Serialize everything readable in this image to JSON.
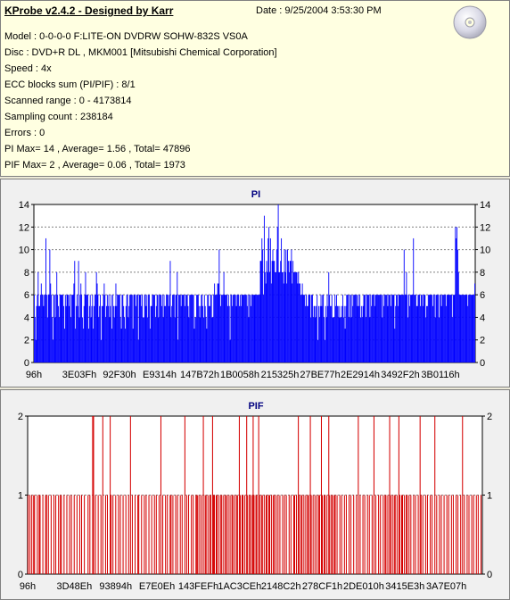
{
  "header": {
    "title": "KProbe v2.4.2 - Designed by Karr",
    "date": "Date : 9/25/2004 3:53:30 PM"
  },
  "info_lines": [
    "Model : 0-0-0-0 F:LITE-ON DVDRW SOHW-832S  VS0A",
    "Disc : DVD+R DL , MKM001 [Mitsubishi Chemical Corporation]",
    "Speed : 4x",
    "ECC blocks sum (PI/PIF) : 8/1",
    "Scanned range : 0 - 4173814",
    "Sampling count : 238184",
    "Errors : 0",
    "PI Max= 14 , Average= 1.56 , Total= 47896",
    "PIF Max= 2 , Average= 0.06 , Total= 1973"
  ],
  "icons": {
    "disc": "cd-disc-icon"
  },
  "colors": {
    "pi": "#0000ff",
    "pif": "#d40000",
    "info_bg": "#ffffe1",
    "panel_bg": "#f0f0f0"
  },
  "chart_data": [
    {
      "type": "bar",
      "title": "PI",
      "ylim": [
        0,
        14
      ],
      "yticks": [
        0,
        2,
        4,
        6,
        8,
        10,
        12,
        14
      ],
      "grid": true,
      "x_tick_labels": [
        "96h",
        "3E03Fh",
        "92F30h",
        "E9314h",
        "147B72h",
        "1B0058h",
        "215325h",
        "27BE77h",
        "2E2914h",
        "3492F2h",
        "3B0116h"
      ],
      "series": [
        {
          "values": [
            6,
            4,
            2,
            5,
            6,
            8,
            5,
            5,
            6,
            7,
            6,
            6,
            5,
            6,
            6,
            11,
            6,
            4,
            6,
            6,
            10,
            7,
            6,
            4,
            2,
            6,
            6,
            4,
            6,
            8,
            6,
            5,
            4,
            6,
            6,
            6,
            6,
            6,
            5,
            3,
            6,
            5,
            6,
            6,
            6,
            5,
            6,
            4,
            6,
            6,
            6,
            7,
            9,
            3,
            5,
            6,
            5,
            9,
            4,
            6,
            7,
            6,
            4,
            3,
            5,
            6,
            8,
            6,
            6,
            6,
            3,
            5,
            6,
            4,
            5,
            6,
            3,
            5,
            6,
            6,
            8,
            7,
            6,
            4,
            5,
            6,
            2,
            5,
            5,
            6,
            7,
            6,
            4,
            5,
            6,
            5,
            6,
            4,
            5,
            6,
            3,
            6,
            5,
            4,
            5,
            7,
            5,
            6,
            6,
            6,
            6,
            4,
            3,
            6,
            6,
            5,
            4,
            3,
            5,
            6,
            6,
            4,
            5,
            6,
            6,
            6,
            6,
            3,
            6,
            6,
            6,
            5,
            6,
            6,
            2,
            6,
            6,
            6,
            5,
            6,
            4,
            4,
            6,
            6,
            5,
            6,
            4,
            6,
            6,
            3,
            5,
            5,
            6,
            6,
            6,
            6,
            4,
            5,
            6,
            6,
            4,
            6,
            6,
            6,
            5,
            6,
            4,
            6,
            5,
            5,
            6,
            6,
            6,
            5,
            6,
            9,
            4,
            5,
            6,
            6,
            6,
            4,
            6,
            6,
            8,
            2,
            6,
            6,
            6,
            5,
            6,
            6,
            6,
            6,
            5,
            6,
            6,
            6,
            5,
            4,
            6,
            6,
            6,
            6,
            6,
            6,
            3,
            4,
            4,
            6,
            6,
            6,
            5,
            4,
            5,
            6,
            6,
            5,
            4,
            6,
            5,
            4,
            3,
            6,
            6,
            5,
            5,
            6,
            6,
            4,
            4,
            6,
            7,
            6,
            6,
            6,
            7,
            7,
            10,
            6,
            5,
            6,
            6,
            6,
            8,
            6,
            6,
            6,
            6,
            5,
            6,
            5,
            2,
            6,
            6,
            5,
            6,
            6,
            6,
            6,
            5,
            6,
            6,
            6,
            5,
            6,
            5,
            6,
            6,
            6,
            6,
            6,
            6,
            6,
            5,
            6,
            4,
            6,
            6,
            5,
            6,
            6,
            6,
            6,
            6,
            6,
            6,
            6,
            6,
            6,
            6,
            9,
            9,
            11,
            10,
            6,
            13,
            8,
            7,
            9,
            8,
            11,
            12,
            8,
            11,
            7,
            9,
            10,
            9,
            9,
            8,
            8,
            10,
            12,
            14,
            8,
            8,
            9,
            11,
            8,
            8,
            7,
            10,
            8,
            10,
            7,
            10,
            9,
            8,
            9,
            9,
            10,
            7,
            9,
            8,
            8,
            8,
            8,
            8,
            7,
            8,
            7,
            7,
            6,
            6,
            7,
            6,
            6,
            6,
            5,
            6,
            5,
            5,
            6,
            6,
            6,
            4,
            6,
            6,
            4,
            5,
            5,
            4,
            5,
            6,
            2,
            5,
            4,
            5,
            6,
            5,
            6,
            6,
            4,
            2,
            5,
            4,
            6,
            5,
            8,
            6,
            5,
            5,
            6,
            4,
            4,
            4,
            6,
            5,
            6,
            5,
            5,
            4,
            5,
            4,
            4,
            5,
            6,
            4,
            5,
            3,
            5,
            6,
            6,
            6,
            4,
            6,
            6,
            4,
            6,
            5,
            6,
            6,
            6,
            6,
            6,
            5,
            6,
            5,
            6,
            4,
            5,
            4,
            5,
            6,
            6,
            6,
            4,
            6,
            6,
            6,
            6,
            4,
            6,
            5,
            6,
            6,
            6,
            5,
            6,
            6,
            6,
            6,
            6,
            6,
            6,
            6,
            6,
            4,
            6,
            5,
            6,
            6,
            6,
            6,
            5,
            6,
            6,
            6,
            5,
            6,
            6,
            6,
            6,
            3,
            5,
            6,
            6,
            5,
            6,
            6,
            6,
            6,
            6,
            6,
            6,
            10,
            6,
            6,
            8,
            6,
            4,
            6,
            5,
            6,
            6,
            6,
            6,
            11,
            6,
            6,
            6,
            5,
            5,
            6,
            6,
            6,
            5,
            6,
            6,
            5,
            6,
            6,
            6,
            4,
            5,
            5,
            6,
            6,
            6,
            6,
            6,
            6,
            5,
            6,
            6,
            4,
            6,
            6,
            6,
            6,
            4,
            6,
            6,
            5,
            6,
            6,
            6,
            6,
            6,
            5,
            6,
            6,
            6,
            6,
            6,
            6,
            6,
            4,
            6,
            6,
            6,
            12,
            11,
            12,
            10,
            8,
            6,
            6,
            6,
            6,
            6,
            6,
            6,
            6,
            6,
            6,
            6,
            5,
            6,
            6,
            6,
            6,
            6,
            6,
            6,
            6,
            7
          ]
        }
      ]
    },
    {
      "type": "bar",
      "title": "PIF",
      "ylim": [
        0,
        2
      ],
      "yticks": [
        0,
        1,
        2
      ],
      "grid": true,
      "x_tick_labels": [
        "96h",
        "3D48Eh",
        "93894h",
        "E7E0Eh",
        "143FEFh",
        "1AC3CEh",
        "2148C2h",
        "278CF1h",
        "2DE010h",
        "3415E3h",
        "3A7E07h"
      ],
      "series": [
        {
          "values": [
            1,
            0,
            1,
            0,
            1,
            0,
            1,
            1,
            0,
            0,
            1,
            0,
            1,
            1,
            0,
            0,
            1,
            0,
            0,
            1,
            1,
            0,
            1,
            0,
            0,
            1,
            0,
            0,
            1,
            0,
            1,
            0,
            0,
            1,
            0,
            1,
            1,
            0,
            0,
            1,
            0,
            0,
            1,
            0,
            0,
            1,
            0,
            1,
            0,
            0,
            1,
            0,
            0,
            1,
            0,
            0,
            1,
            0,
            1,
            0,
            0,
            1,
            0,
            0,
            0,
            1,
            0,
            1,
            0,
            0,
            2,
            2,
            0,
            1,
            0,
            0,
            1,
            0,
            0,
            1,
            0,
            2,
            0,
            0,
            1,
            0,
            1,
            0,
            0,
            2,
            1,
            0,
            1,
            0,
            0,
            1,
            0,
            0,
            1,
            0,
            1,
            0,
            0,
            1,
            0,
            0,
            1,
            0,
            0,
            1,
            0,
            2,
            0,
            1,
            0,
            0,
            1,
            0,
            0,
            1,
            1,
            0,
            0,
            1,
            0,
            0,
            1,
            0,
            1,
            0,
            0,
            1,
            0,
            0,
            1,
            0,
            0,
            1,
            0,
            1,
            0,
            0,
            1,
            0,
            2,
            0,
            1,
            0,
            0,
            1,
            0,
            1,
            0,
            0,
            1,
            1,
            0,
            1,
            0,
            0,
            1,
            0,
            1,
            0,
            0,
            1,
            0,
            1,
            0,
            0,
            2,
            0,
            1,
            0,
            1,
            0,
            0,
            1,
            0,
            1,
            0,
            0,
            1,
            1,
            1,
            0,
            1,
            0,
            1,
            0,
            2,
            0,
            1,
            1,
            0,
            1,
            0,
            1,
            1,
            0,
            2,
            1,
            1,
            0,
            1,
            1,
            0,
            1,
            0,
            1,
            1,
            0,
            1,
            0,
            1,
            1,
            0,
            1,
            0,
            1,
            0,
            1,
            1,
            0,
            1,
            0,
            1,
            1,
            0,
            2,
            1,
            0,
            1,
            1,
            0,
            1,
            0,
            2,
            1,
            0,
            1,
            1,
            0,
            1,
            2,
            1,
            0,
            1,
            1,
            0,
            2,
            1,
            0,
            1,
            1,
            0,
            1,
            0,
            1,
            1,
            0,
            1,
            1,
            0,
            1,
            0,
            1,
            1,
            0,
            1,
            0,
            1,
            0,
            1,
            0,
            0,
            1,
            0,
            1,
            0,
            1,
            0,
            0,
            1,
            0,
            1,
            0,
            0,
            1,
            1,
            0,
            1,
            0,
            2,
            1,
            0,
            1,
            1,
            0,
            1,
            0,
            1,
            0,
            1,
            1,
            0,
            2,
            1,
            0,
            1,
            0,
            1,
            0,
            1,
            0,
            1,
            1,
            0,
            2,
            1,
            0,
            1,
            1,
            0,
            1,
            0,
            2,
            1,
            0,
            1,
            1,
            0,
            1,
            1,
            0,
            1,
            0,
            0,
            1,
            0,
            1,
            0,
            0,
            1,
            0,
            1,
            0,
            0,
            1,
            0,
            1,
            0,
            0,
            1,
            0,
            0,
            1,
            0,
            2,
            0,
            1,
            0,
            0,
            1,
            0,
            1,
            0,
            0,
            1,
            0,
            1,
            0,
            0,
            1,
            0,
            2,
            0,
            1,
            0,
            0,
            1,
            0,
            1,
            0,
            0,
            1,
            0,
            1,
            1,
            0,
            1,
            0,
            2,
            1,
            0,
            1,
            0,
            1,
            1,
            0,
            1,
            0,
            2,
            1,
            0,
            1,
            1,
            0,
            1,
            0,
            1,
            1,
            0,
            1,
            0,
            1,
            0,
            0,
            1,
            0,
            1,
            0,
            0,
            1,
            0,
            2,
            1,
            0,
            1,
            0,
            0,
            1,
            0,
            1,
            0,
            0,
            1,
            0,
            1,
            0,
            0,
            2,
            0,
            1,
            0,
            0,
            1,
            0,
            1,
            0,
            0,
            1,
            0,
            0,
            1,
            0,
            1,
            0,
            0,
            1,
            0,
            1,
            0,
            0,
            1,
            0,
            1,
            0,
            0,
            1,
            0,
            2,
            0,
            1,
            0,
            0,
            1,
            0,
            1,
            0,
            0,
            1,
            0,
            1,
            0,
            0,
            1,
            0,
            1,
            0,
            0,
            1,
            0
          ]
        }
      ]
    }
  ]
}
